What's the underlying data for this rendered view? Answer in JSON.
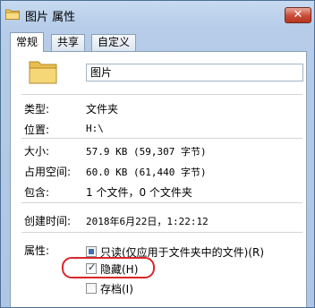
{
  "window": {
    "title": "图片 属性",
    "close_glyph": "✕"
  },
  "tabs": [
    {
      "label": "常规",
      "active": true
    },
    {
      "label": "共享",
      "active": false
    },
    {
      "label": "自定义",
      "active": false
    }
  ],
  "general": {
    "name_value": "图片",
    "rows": [
      {
        "label": "类型:",
        "value": "文件夹"
      },
      {
        "label": "位置:",
        "value": "H:\\"
      },
      {
        "label": "大小:",
        "value": "57.9 KB (59,307 字节)"
      },
      {
        "label": "占用空间:",
        "value": "60.0 KB (61,440 字节)"
      },
      {
        "label": "包含:",
        "value": "1 个文件，0 个文件夹"
      },
      {
        "label": "创建时间:",
        "value": "2018年6月22日，1:22:12"
      }
    ],
    "attributes": {
      "label": "属性:",
      "readonly": {
        "label": "只读(仅应用于文件夹中的文件)(R)",
        "state": "indeterminate"
      },
      "hidden": {
        "label": "隐藏(H)",
        "state": "checked"
      },
      "archive": {
        "label": "存档(I)",
        "state": "unchecked"
      }
    }
  },
  "icons": {
    "title_icon": "folder-icon",
    "folder_icon": "folder-icon",
    "checkmark": "✓"
  },
  "colors": {
    "highlight": "#d9262a",
    "close_button": "#c94a35",
    "folder": "#f2cf6b"
  }
}
